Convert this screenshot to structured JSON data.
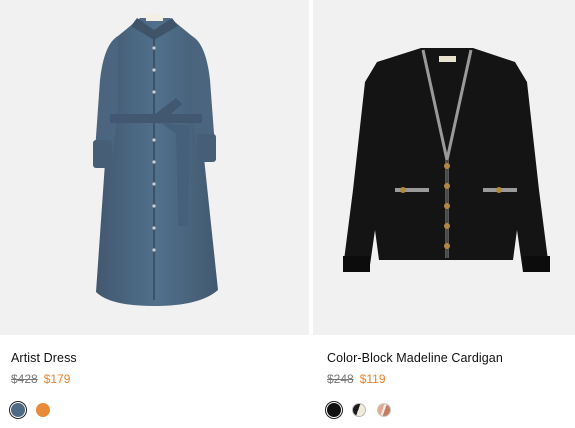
{
  "products": [
    {
      "name": "Artist Dress",
      "original_price": "$428",
      "sale_price": "$179",
      "image_alt": "blue-shirt-dress",
      "swatches": [
        {
          "color": "#4f6a85",
          "selected": true
        },
        {
          "color": "#e98a3a",
          "selected": false
        }
      ]
    },
    {
      "name": "Color-Block Madeline Cardigan",
      "original_price": "$248",
      "sale_price": "$119",
      "image_alt": "black-cardigan",
      "swatches": [
        {
          "color": "#111111",
          "selected": true
        },
        {
          "color": "split-black-cream",
          "selected": false
        },
        {
          "color": "split-pink-stripe",
          "selected": false
        }
      ]
    }
  ],
  "colors": {
    "sale": "#e8822d",
    "original": "#777777",
    "image_bg": "#f1f1f1"
  }
}
